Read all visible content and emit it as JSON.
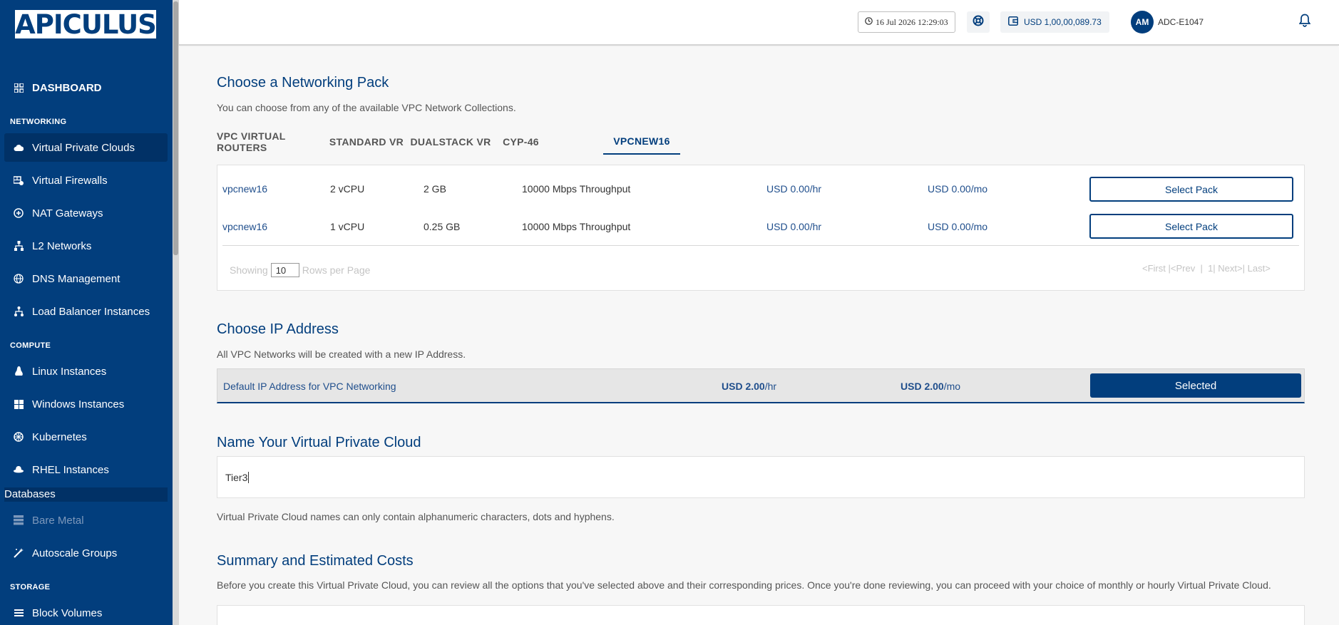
{
  "sidebar": {
    "logo": "APICULUS",
    "dashboard": "DASHBOARD",
    "networking_label": "NETWORKING",
    "networking": [
      "Virtual Private Clouds",
      "Virtual Firewalls",
      "NAT Gateways",
      "L2 Networks",
      "DNS Management",
      "Load Balancer Instances"
    ],
    "compute_label": "COMPUTE",
    "compute": [
      "Linux Instances",
      "Windows Instances",
      "Kubernetes",
      "RHEL Instances"
    ],
    "databases": "Databases",
    "compute_more": [
      "Bare Metal",
      "Autoscale Groups"
    ],
    "storage_label": "STORAGE",
    "storage": [
      "Block Volumes"
    ],
    "active_item": "Virtual Private Clouds"
  },
  "header": {
    "datetime": "16 Jul 2026 12:29:03",
    "balance": "USD 1,00,00,089.73",
    "avatar_initials": "AM",
    "user_id": "ADC-E1047"
  },
  "networking_pack": {
    "title": "Choose a Networking Pack",
    "subtitle": "You can choose from any of the available VPC Network Collections.",
    "tabs": [
      "VPC VIRTUAL ROUTERS",
      "STANDARD VR",
      "DUALSTACK VR",
      "CYP-46",
      "VPCNEW16"
    ],
    "active_tab": "VPCNEW16",
    "rows": [
      {
        "name": "vpcnew16",
        "cpu": "2 vCPU",
        "ram": "2 GB",
        "throughput": "10000 Mbps Throughput",
        "hourly": "USD 0.00/hr",
        "monthly": "USD 0.00/mo",
        "action": "Select Pack"
      },
      {
        "name": "vpcnew16",
        "cpu": "1 vCPU",
        "ram": "0.25 GB",
        "throughput": "10000 Mbps Throughput",
        "hourly": "USD 0.00/hr",
        "monthly": "USD 0.00/mo",
        "action": "Select Pack"
      }
    ],
    "pagination": {
      "showing": "Showing",
      "rows_per_page_value": "10",
      "rows_per_page": "Rows per Page",
      "first": "<First",
      "prev": "|<Prev",
      "sep1": "|",
      "page": "1|",
      "next": "Next>|",
      "last": "Last>"
    }
  },
  "ip_address": {
    "title": "Choose IP Address",
    "subtitle": "All VPC Networks will be created with a new IP Address.",
    "label": "Default IP Address for VPC Networking",
    "hourly_amount": "USD 2.00",
    "hourly_unit": "/hr",
    "monthly_amount": "USD 2.00",
    "monthly_unit": "/mo",
    "button": "Selected"
  },
  "name_vpc": {
    "title": "Name Your Virtual Private Cloud",
    "value": "Tier3",
    "hint": "Virtual Private Cloud names can only contain alphanumeric characters, dots and hyphens."
  },
  "summary": {
    "title": "Summary and Estimated Costs",
    "subtitle": "Before you create this Virtual Private Cloud, you can review all the options that you've selected above and their corresponding prices. Once you're done reviewing, you can proceed with your choice of monthly or hourly Virtual Private Cloud."
  }
}
